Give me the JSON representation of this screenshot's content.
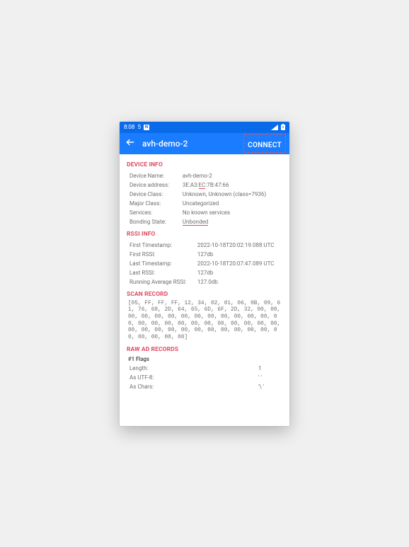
{
  "statusbar": {
    "time": "8:08",
    "notif_count": "5"
  },
  "appbar": {
    "title": "avh-demo-2",
    "connect_label": "CONNECT"
  },
  "sections": {
    "device_info_title": "DEVICE INFO",
    "rssi_info_title": "RSSI INFO",
    "scan_record_title": "SCAN RECORD",
    "raw_ad_title": "RAW AD RECORDS",
    "flags_sub": "#1 Flags"
  },
  "device_info": [
    {
      "k": "Device Name:",
      "v": "avh-demo-2"
    },
    {
      "k": "Device address:",
      "v_pre": "3E:A3:",
      "v_mid": "EC",
      "v_post": ":7B:47:66"
    },
    {
      "k": "Device Class:",
      "v": "Unknown, Unknown (class=7936)"
    },
    {
      "k": "Major Class:",
      "v": "Uncategorized"
    },
    {
      "k": "Services:",
      "v": "No known services"
    },
    {
      "k": "Bonding State:",
      "v_link": "Unbonded"
    }
  ],
  "rssi_info": [
    {
      "k": "First Timestamp:",
      "v": "2022-10-18T20:02:19.088 UTC"
    },
    {
      "k": "First RSSI:",
      "v": "127db"
    },
    {
      "k": "Last Timestamp:",
      "v": "2022-10-18T20:07:47.089 UTC"
    },
    {
      "k": "Last RSSI:",
      "v": "127db"
    },
    {
      "k": "Running Average RSSI:",
      "v": "127.0db"
    }
  ],
  "scan_record_hex": "[05, FF, FF, FF, 12, 34, 02, 01, 06, 0B, 09, 61, 76, 68, 2D, 64, 65, 6D, 6F, 2D, 32, 00, 00, 00, 00, 00, 00, 00, 00, 00, 00, 00, 00, 00, 00, 00, 00, 00, 00, 00, 00, 00, 00, 00, 00, 00, 00, 00, 00, 00, 00, 00, 00, 00, 00, 00, 00, 00, 00, 00, 00, 00]",
  "flags": [
    {
      "k": "Length:",
      "v": "1"
    },
    {
      "k": "As UTF-8:",
      "v": "' '"
    },
    {
      "k": "As Chars:",
      "v": "'\\ '"
    }
  ]
}
